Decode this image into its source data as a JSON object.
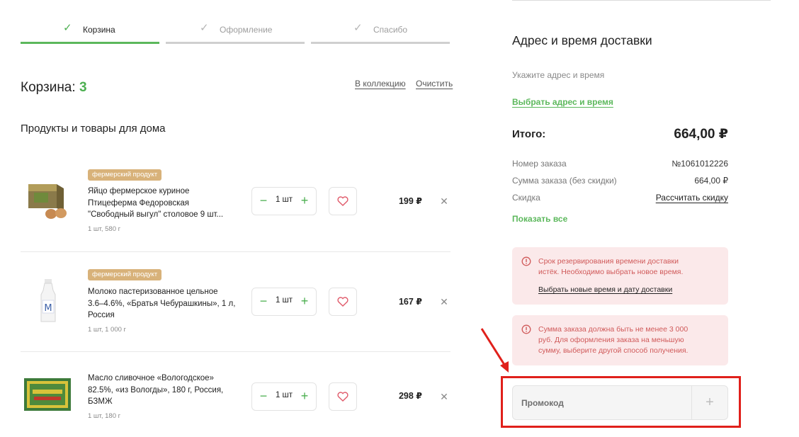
{
  "steps": [
    {
      "label": "Корзина",
      "state": "active"
    },
    {
      "label": "Оформление",
      "state": "done"
    },
    {
      "label": "Спасибо",
      "state": "done"
    }
  ],
  "cart": {
    "title": "Корзина:",
    "count": "3",
    "to_collection": "В коллекцию",
    "clear": "Очистить",
    "section_title": "Продукты и товары для дома"
  },
  "items": [
    {
      "badge": "фермерский продукт",
      "name_lines": [
        "Яйцо фермерское куриное",
        "Птицеферма Федоровская",
        "\"Свободный выгул\" столовое 9 шт..."
      ],
      "meta": "1 шт, 580 г",
      "qty": "1 шт",
      "price": "199 ₽"
    },
    {
      "badge": "фермерский продукт",
      "name_lines": [
        "Молоко пастеризованное цельное",
        "3.6–4.6%, «Братья Чебурашкины», 1 л,",
        "Россия"
      ],
      "meta": "1 шт, 1 000 г",
      "qty": "1 шт",
      "price": "167 ₽"
    },
    {
      "badge": "",
      "name_lines": [
        "Масло сливочное «Вологодское»",
        "82.5%, «из Вологды», 180 г, Россия,",
        "БЗМЖ"
      ],
      "meta": "1 шт, 180 г",
      "qty": "1 шт",
      "price": "298 ₽"
    }
  ],
  "delivery": {
    "title": "Адрес и время доставки",
    "hint": "Укажите адрес и время",
    "choose_link": "Выбрать адрес и время"
  },
  "summary": {
    "total_label": "Итого:",
    "total_value": "664,00 ₽",
    "rows": [
      {
        "label": "Номер заказа",
        "value": "№1061012226"
      },
      {
        "label": "Сумма заказа (без скидки)",
        "value": "664,00 ₽"
      },
      {
        "label": "Скидка",
        "value": "Рассчитать скидку"
      }
    ],
    "show_all": "Показать все"
  },
  "alerts": [
    {
      "lines": [
        "Срок резервирования времени доставки",
        "истёк. Необходимо выбрать новое время."
      ],
      "link": "Выбрать новые время и дату доставки"
    },
    {
      "lines": [
        "Сумма заказа должна быть не менее 3 000",
        "руб. Для оформления заказа на меньшую",
        "сумму, выберите другой способ получения."
      ],
      "link": ""
    }
  ],
  "promo": {
    "placeholder": "Промокод",
    "add_symbol": "+"
  },
  "colors": {
    "accent": "#4caf50",
    "badge": "#d8b27a",
    "alert_bg": "#fbe9ea",
    "alert_text": "#d05a5a",
    "annotation": "#e0201b"
  },
  "icons": {
    "step": "check-icon",
    "quantity": [
      "minus-icon",
      "plus-icon"
    ],
    "favorite": "heart-icon",
    "remove": "close-icon",
    "alert": "exclamation-circle-icon"
  }
}
